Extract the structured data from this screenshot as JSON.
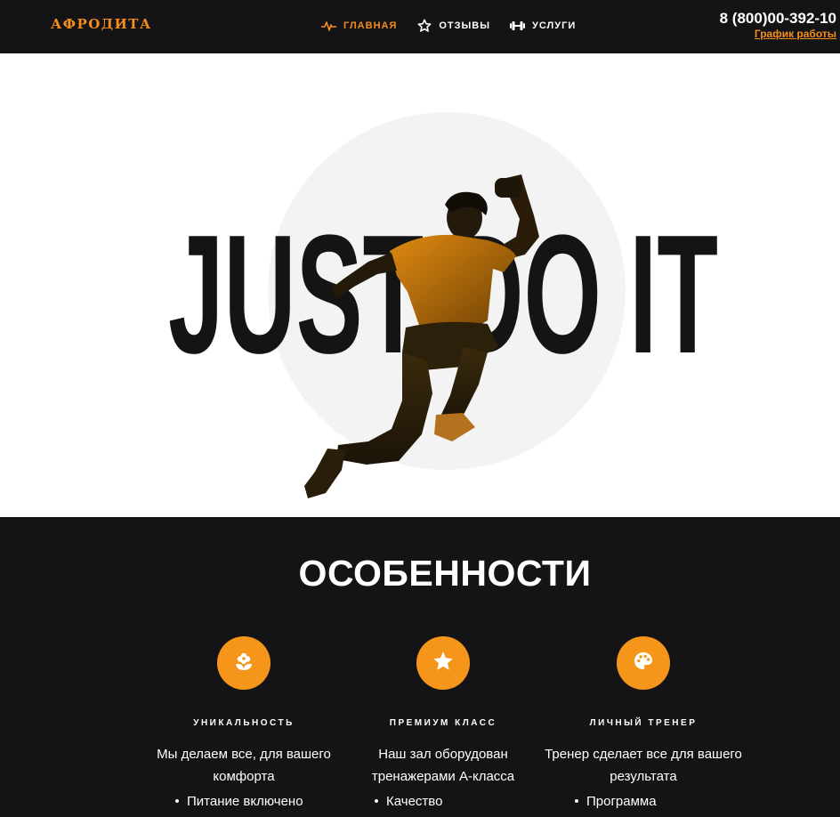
{
  "header": {
    "logo": "АФРОДИТА",
    "nav": [
      {
        "label": "ГЛАВНАЯ",
        "icon": "pulse-icon",
        "active": true
      },
      {
        "label": "ОТЗЫВЫ",
        "icon": "star-outline-icon",
        "active": false
      },
      {
        "label": "УСЛУГИ",
        "icon": "dumbbell-icon",
        "active": false
      }
    ],
    "phone": "8 (800)00-392-10",
    "schedule_link": "График работы"
  },
  "hero": {
    "slogan": "JUST DO IT",
    "image": "jumping-athlete-image"
  },
  "features": {
    "title": "ОСОБЕННОСТИ",
    "items": [
      {
        "icon": "flower-icon",
        "title": "УНИКАЛЬНОСТЬ",
        "description": "Мы делаем все, для вашего комфорта",
        "bullets": [
          "Питание включено"
        ]
      },
      {
        "icon": "star-icon",
        "title": "ПРЕМИУМ КЛАСС",
        "description": "Наш зал оборудован тренажерами А-класса",
        "bullets": [
          "Качество"
        ]
      },
      {
        "icon": "palette-icon",
        "title": "ЛИЧНЫЙ ТРЕНЕР",
        "description": "Тренер сделает все для вашего результата",
        "bullets": [
          "Программа"
        ]
      }
    ]
  },
  "colors": {
    "accent": "#f58d1c",
    "dark": "#141416",
    "hero_bg": "#ffffff",
    "slogan": "#141414"
  }
}
